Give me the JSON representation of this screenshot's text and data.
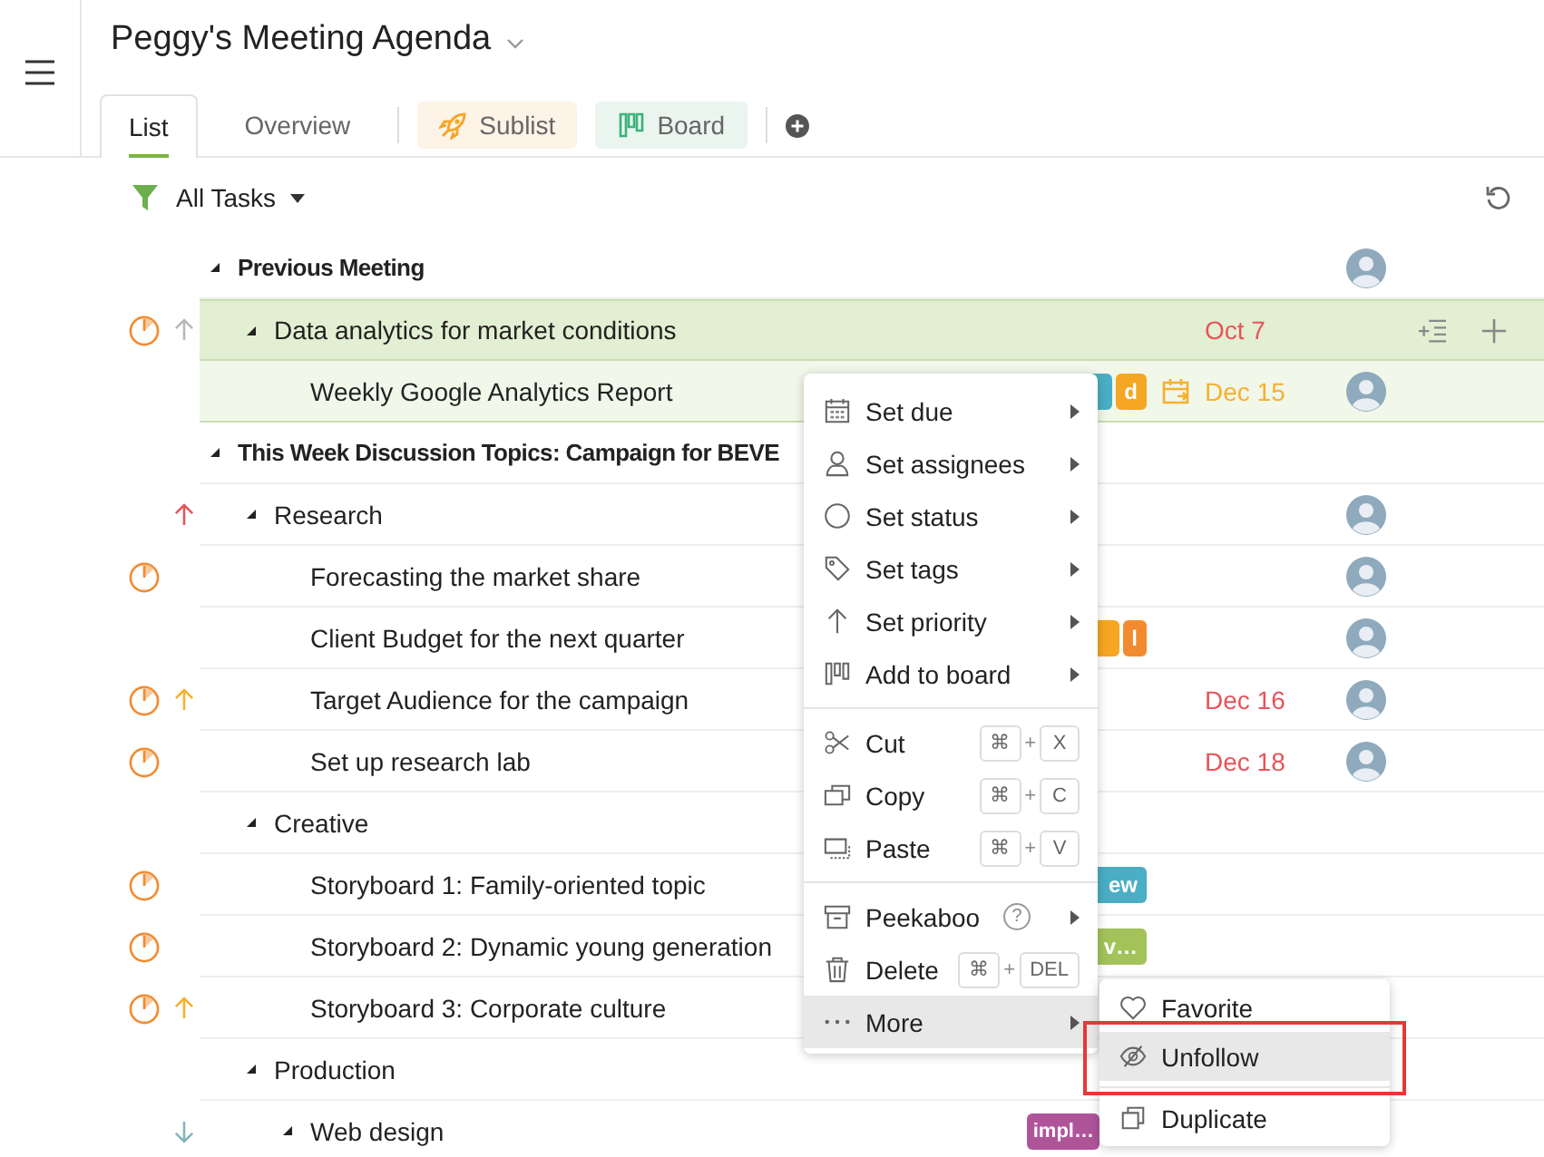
{
  "header": {
    "title": "Peggy's Meeting Agenda"
  },
  "tabs": [
    {
      "label": "List",
      "kind": "tab",
      "selected": true
    },
    {
      "label": "Overview",
      "kind": "tab",
      "selected": false
    },
    {
      "label": "Sublist",
      "kind": "chip",
      "color": "#fdf3e6",
      "selected": false
    },
    {
      "label": "Board",
      "kind": "chip",
      "color": "#e9f5ee",
      "selected": false
    }
  ],
  "filter": {
    "label": "All Tasks"
  },
  "rows": [
    {
      "kind": "section",
      "title": "Previous Meeting",
      "expanded": true,
      "selected": false,
      "hovered": false,
      "avatar": true,
      "children": [
        {
          "kind": "group",
          "title": "Data analytics for market conditions",
          "expanded": true,
          "selected": true,
          "hovered": false,
          "status": true,
          "priority": {
            "kind": "up",
            "color": "#b8b8b8"
          },
          "date": {
            "text": "Oct 7",
            "kind": "overdue"
          },
          "children": [
            {
              "kind": "task",
              "title": "Weekly Google Analytics Report",
              "selected": false,
              "hovered": true,
              "tags": [
                {
                  "color": "#4aaec4",
                  "cut_left": true,
                  "cut_right": false
                },
                {
                  "text": "d",
                  "color": "#f5a623",
                  "cut_left": false,
                  "cut_right": false
                }
              ],
              "date": {
                "text": "Dec 15",
                "kind": "upcoming"
              },
              "avatar": true
            }
          ]
        }
      ]
    },
    {
      "kind": "section",
      "title": "This Week Discussion Topics: Campaign for BEVE",
      "expanded": true,
      "selected": false,
      "hovered": false,
      "children": [
        {
          "kind": "group",
          "title": "Research",
          "expanded": true,
          "selected": false,
          "hovered": false,
          "priority": {
            "kind": "up",
            "color": "#e8535a"
          },
          "avatar": true,
          "children": [
            {
              "kind": "task",
              "title": "Forecasting the market share",
              "selected": false,
              "hovered": false,
              "status": true,
              "avatar": true
            },
            {
              "kind": "task",
              "title": "Client Budget for the next quarter",
              "selected": false,
              "hovered": false,
              "tags": [
                {
                  "color": "#f5a623",
                  "cut_left": true,
                  "cut_right": false
                },
                {
                  "text": "l",
                  "color": "#f28b30",
                  "cut_left": false,
                  "cut_right": false
                }
              ],
              "avatar": true
            },
            {
              "kind": "task",
              "title": "Target Audience for the campaign",
              "selected": false,
              "hovered": false,
              "status": true,
              "priority": {
                "kind": "up",
                "color": "#f7b02c"
              },
              "date": {
                "text": "Dec 16",
                "kind": "overdue"
              },
              "avatar": true
            },
            {
              "kind": "task",
              "title": "Set up research lab",
              "selected": false,
              "hovered": false,
              "status": true,
              "date": {
                "text": "Dec 18",
                "kind": "overdue"
              },
              "avatar": true
            }
          ]
        },
        {
          "kind": "group",
          "title": "Creative",
          "expanded": true,
          "selected": false,
          "hovered": false,
          "children": [
            {
              "kind": "task",
              "title": "Storyboard 1: Family-oriented topic",
              "selected": false,
              "hovered": false,
              "status": true,
              "tags": [
                {
                  "text": "ew",
                  "color": "#4aaec4",
                  "cut_left": true,
                  "cut_right": false
                }
              ]
            },
            {
              "kind": "task",
              "title": "Storyboard 2: Dynamic young generation",
              "selected": false,
              "hovered": false,
              "status": true,
              "tags": [
                {
                  "text": "v…",
                  "color": "#a3c35a",
                  "cut_left": true,
                  "cut_right": false
                }
              ]
            },
            {
              "kind": "task",
              "title": "Storyboard 3: Corporate culture",
              "selected": false,
              "hovered": false,
              "status": true,
              "priority": {
                "kind": "up",
                "color": "#f7b02c"
              }
            }
          ]
        },
        {
          "kind": "group",
          "title": "Production",
          "expanded": true,
          "selected": false,
          "hovered": false,
          "children": [
            {
              "kind": "group",
              "title": "Web design",
              "expanded": true,
              "selected": false,
              "hovered": false,
              "priority": {
                "kind": "down",
                "color": "#86b5b9"
              },
              "tags": [
                {
                  "text": "impl…",
                  "color": "#b0549a",
                  "cut_left": false,
                  "cut_right": true
                }
              ]
            }
          ]
        }
      ]
    }
  ],
  "context_menu": {
    "groups": [
      [
        {
          "label": "Set due",
          "kind": "submenu",
          "selected": false
        },
        {
          "label": "Set assignees",
          "kind": "submenu",
          "selected": false
        },
        {
          "label": "Set status",
          "kind": "submenu",
          "selected": false
        },
        {
          "label": "Set tags",
          "kind": "submenu",
          "selected": false
        },
        {
          "label": "Set priority",
          "kind": "submenu",
          "selected": false
        },
        {
          "label": "Add to board",
          "kind": "submenu",
          "selected": false
        }
      ],
      [
        {
          "label": "Cut",
          "kind": "shortcut",
          "shortcut": [
            "⌘",
            "+",
            "X"
          ],
          "selected": false
        },
        {
          "label": "Copy",
          "kind": "shortcut",
          "shortcut": [
            "⌘",
            "+",
            "C"
          ],
          "selected": false
        },
        {
          "label": "Paste",
          "kind": "shortcut",
          "shortcut": [
            "⌘",
            "+",
            "V"
          ],
          "selected": false
        }
      ],
      [
        {
          "label": "Peekaboo",
          "kind": "submenu",
          "help": "?",
          "selected": false
        },
        {
          "label": "Delete",
          "kind": "shortcut",
          "shortcut": [
            "⌘",
            "+",
            "DEL"
          ],
          "selected": false
        },
        {
          "label": "More",
          "kind": "submenu",
          "selected": true
        }
      ]
    ]
  },
  "submenu": {
    "groups": [
      [
        {
          "label": "Favorite",
          "selected": false,
          "annotated": false
        },
        {
          "label": "Unfollow",
          "selected": true,
          "annotated": true
        }
      ],
      [
        {
          "label": "Duplicate",
          "selected": false,
          "annotated": false
        }
      ]
    ]
  }
}
